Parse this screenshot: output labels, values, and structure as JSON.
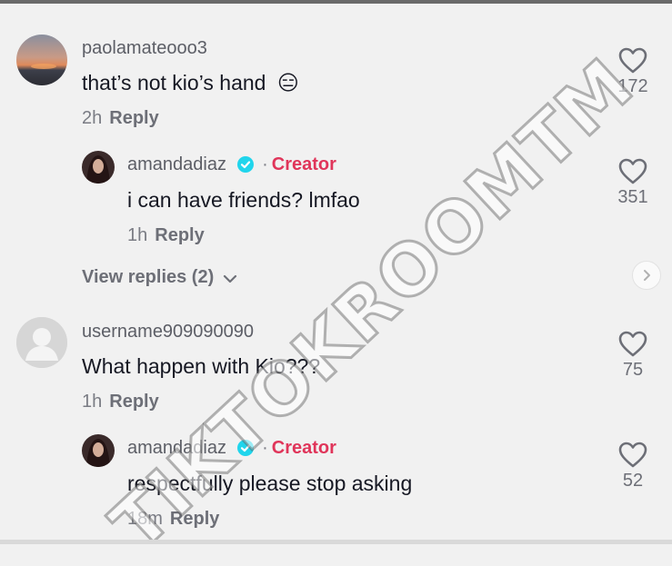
{
  "comments": [
    {
      "username": "paolamateooo3",
      "text": "that’s not kio’s hand",
      "emoji": "😑",
      "time": "2h",
      "reply_label": "Reply",
      "likes": "172",
      "avatar": "sunset-photo"
    },
    {
      "username": "amandadiaz",
      "creator_label": "Creator",
      "separator": "·",
      "text": "i can have friends? lmfao",
      "time": "1h",
      "reply_label": "Reply",
      "likes": "351",
      "avatar": "profile-photo"
    },
    {
      "username": "username909090090",
      "text": "What happen with Kio???",
      "time": "1h",
      "reply_label": "Reply",
      "likes": "75",
      "avatar": "default-avatar"
    },
    {
      "username": "amandadiaz",
      "creator_label": "Creator",
      "separator": "·",
      "text": "respectfully please stop asking",
      "time": "18m",
      "reply_label": "Reply",
      "likes": "52",
      "avatar": "profile-photo"
    }
  ],
  "view_replies": "View replies (2)",
  "watermark": "TIKTOKROOMTM",
  "colors": {
    "background": "#f1f1f1",
    "creator": "#e0355a",
    "verified": "#20d5ec",
    "text": "#161823",
    "muted": "#7a7c84"
  }
}
